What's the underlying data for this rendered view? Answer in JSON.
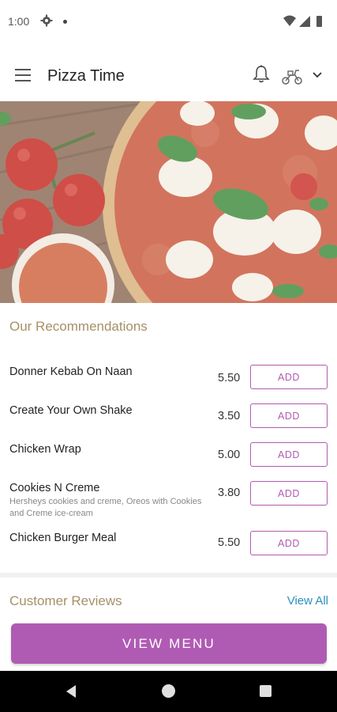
{
  "status_bar": {
    "time": "1:00",
    "icons": [
      "gear-icon",
      "dot-icon",
      "wifi-icon",
      "signal-icon",
      "battery-icon"
    ]
  },
  "app_bar": {
    "title": "Pizza Time",
    "icons": [
      "menu-icon",
      "bell-icon",
      "scooter-icon",
      "chevron-down-icon"
    ]
  },
  "recommendations": {
    "title": "Our Recommendations",
    "items": [
      {
        "name": "Donner Kebab On Naan",
        "description": "",
        "price": "5.50",
        "button": "ADD"
      },
      {
        "name": "Create Your Own Shake",
        "description": "",
        "price": "3.50",
        "button": "ADD"
      },
      {
        "name": "Chicken Wrap",
        "description": "",
        "price": "5.00",
        "button": "ADD"
      },
      {
        "name": "Cookies N Creme",
        "description": "Hersheys cookies and creme, Oreos with Cookies and Creme ice-cream",
        "price": "3.80",
        "button": "ADD"
      },
      {
        "name": "Chicken Burger Meal",
        "description": "",
        "price": "5.50",
        "button": "ADD"
      }
    ]
  },
  "reviews": {
    "title": "Customer Reviews",
    "view_all": "View All"
  },
  "view_menu_label": "VIEW MENU",
  "colors": {
    "accent": "#b05bb3",
    "section_title": "#a69068",
    "link": "#2a8fbd"
  }
}
